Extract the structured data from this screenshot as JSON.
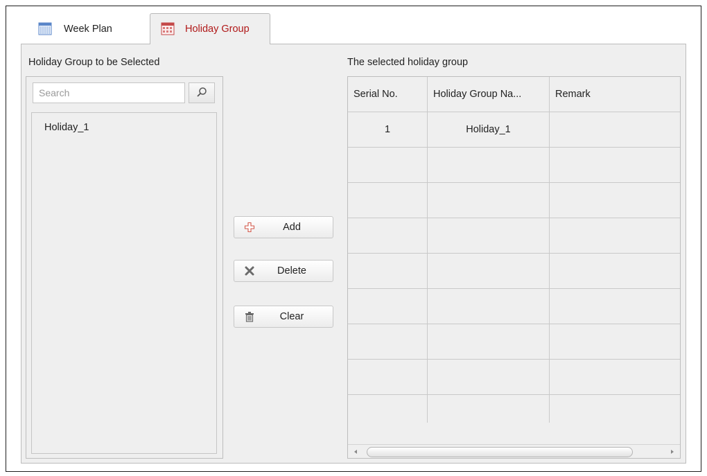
{
  "tabs": [
    {
      "label": "Week Plan",
      "icon": "calendar-week-icon",
      "active": false
    },
    {
      "label": "Holiday Group",
      "icon": "calendar-holiday-icon",
      "active": true
    }
  ],
  "left_panel": {
    "title": "Holiday Group to be Selected",
    "search_placeholder": "Search",
    "search_value": "",
    "items": [
      {
        "label": "Holiday_1"
      }
    ]
  },
  "actions": {
    "add_label": "Add",
    "delete_label": "Delete",
    "clear_label": "Clear"
  },
  "right_panel": {
    "title": "The selected holiday group",
    "columns": [
      "Serial No.",
      "Holiday Group Na...",
      "Remark"
    ],
    "rows": [
      [
        "1",
        "Holiday_1",
        ""
      ]
    ],
    "empty_rows": 8
  },
  "colors": {
    "active_tab_text": "#b01818",
    "panel_bg": "#efefef",
    "border": "#bdbdbd"
  }
}
